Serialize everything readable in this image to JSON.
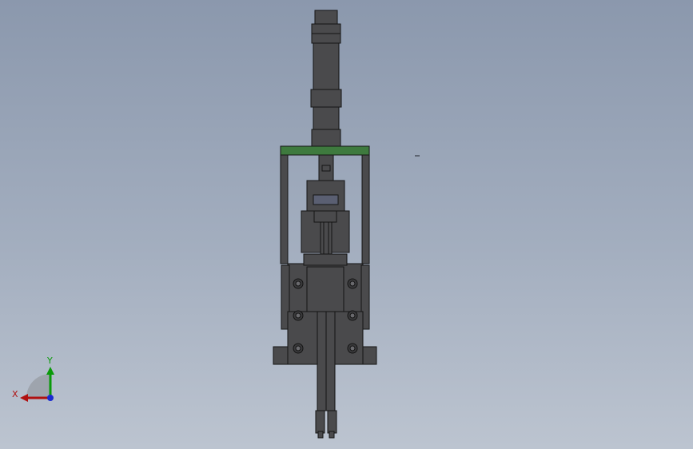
{
  "viewport": {
    "background_top": "#8b98ad",
    "background_bottom": "#bcc4d0"
  },
  "model": {
    "body_color": "#4a4a4c",
    "edge_color": "#141414",
    "plate_color": "#3e7a3e",
    "fastener_icon": "socket-head-screw-icon"
  },
  "triad": {
    "x_label": "X",
    "y_label": "Y",
    "x_color": "#b01010",
    "y_color": "#0a9a0a",
    "z_color": "#1a2ad0"
  }
}
